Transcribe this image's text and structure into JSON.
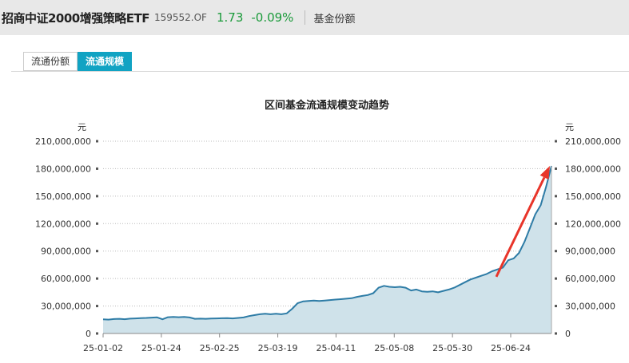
{
  "header": {
    "fund_name": "招商中证2000增强策略ETF",
    "fund_code": "159552.OF",
    "price": "1.73",
    "change": "-0.09%",
    "nav_label": "基金份额",
    "price_color": "#1a9a3a"
  },
  "tabs": [
    {
      "label": "流通份额",
      "active": false
    },
    {
      "label": "流通规模",
      "active": true
    }
  ],
  "chart_data": {
    "type": "area",
    "title": "区间基金流通规模变动趋势",
    "y_unit": "元",
    "ylim": [
      0,
      210000000
    ],
    "y_ticks": [
      0,
      30000000,
      60000000,
      90000000,
      120000000,
      150000000,
      180000000,
      210000000
    ],
    "y_tick_labels": [
      "0",
      "30,000,000",
      "60,000,000",
      "90,000,000",
      "120,000,000",
      "150,000,000",
      "180,000,000",
      "210,000,000"
    ],
    "x_tick_labels": [
      "25-01-02",
      "25-01-24",
      "25-02-25",
      "25-03-19",
      "25-04-11",
      "25-05-08",
      "25-05-30",
      "25-06-24"
    ],
    "grid": true,
    "line_color": "#2e7ca6",
    "fill_color": "#cfe2ea",
    "series": [
      {
        "values": [
          15.5,
          15.2,
          15.8,
          16.0,
          15.6,
          16.2,
          16.5,
          16.8,
          17.0,
          17.3,
          17.6,
          15.5,
          17.8,
          18.0,
          17.8,
          18.0,
          17.5,
          16.0,
          16.2,
          16.0,
          16.3,
          16.5,
          16.6,
          16.8,
          16.5,
          17.0,
          17.5,
          19.0,
          20.0,
          21.0,
          21.5,
          21.0,
          21.5,
          21.0,
          22.0,
          27.0,
          33.0,
          35.0,
          35.5,
          36.0,
          35.5,
          36.0,
          36.5,
          37.0,
          37.5,
          38.0,
          38.5,
          40.0,
          41.0,
          42.0,
          44.0,
          50.0,
          52.0,
          51.0,
          50.5,
          51.0,
          50.0,
          47.0,
          48.0,
          46.0,
          45.5,
          46.0,
          45.0,
          46.5,
          48.0,
          50.0,
          53.0,
          56.0,
          59.0,
          61.0,
          63.0,
          65.0,
          68.0,
          70.0,
          72.0,
          80.0,
          82.0,
          88.0,
          100.0,
          115.0,
          130.0,
          140.0,
          160.0,
          183.0
        ],
        "unit_scale": "millions"
      }
    ],
    "annotation": {
      "type": "arrow",
      "color": "#e8352a",
      "from_value": 62,
      "to_value": 183
    }
  }
}
